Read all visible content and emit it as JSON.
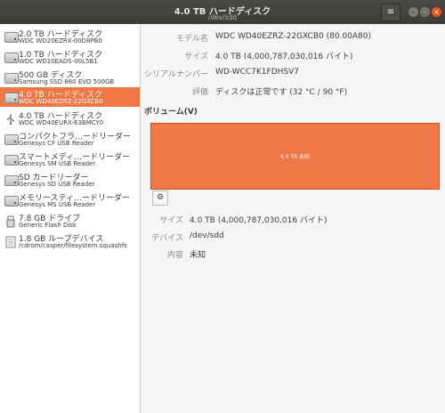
{
  "window": {
    "title": "4.0 TB ハードディスク",
    "subtitle": "/dev/sdd",
    "menu_icon": "hamburger-menu-icon"
  },
  "sidebar": {
    "items": [
      {
        "l1": "2.0 TB ハードディスク",
        "l2": "WDC WD20EZRX-00D8PB0",
        "icon": "hard-disk-icon"
      },
      {
        "l1": "1.0 TB ハードディスク",
        "l2": "WDC WD10EADS-00L5B1",
        "icon": "hard-disk-icon"
      },
      {
        "l1": "500 GB ディスク",
        "l2": "Samsung SSD 860 EVO 500GB",
        "icon": "hard-disk-icon"
      },
      {
        "l1": "4.0 TB ハードディスク",
        "l2": "WDC WD40EZRZ-22GXCB0",
        "icon": "hard-disk-icon",
        "selected": true
      },
      {
        "l1": "4.0 TB ハードディスク",
        "l2": "WDC WD40EURX-63BMCY0",
        "icon": "usb-disk-icon"
      },
      {
        "l1": "コンパクトフラ…ードリーダー",
        "l2": "Genesys CF  USB Reader",
        "icon": "card-reader-icon"
      },
      {
        "l1": "スマートメディ…ードリーダー",
        "l2": "Genesys SM  USB Reader",
        "icon": "card-reader-icon"
      },
      {
        "l1": "SD カードリーダー",
        "l2": "Genesys SD  USB Reader",
        "icon": "card-reader-icon"
      },
      {
        "l1": "メモリースティ…ードリーダー",
        "l2": "Genesys MS  USB Reader",
        "icon": "card-reader-icon"
      },
      {
        "l1": "7.8 GB ドライブ",
        "l2": "Generic Flash Disk",
        "icon": "usb-drive-icon"
      },
      {
        "l1": "1.8 GB ループデバイス",
        "l2": "/cdrom/casper/filesystem.squashfs",
        "icon": "loop-device-icon"
      }
    ]
  },
  "details": {
    "model_label": "モデル名",
    "model_value": "WDC WD40EZRZ-22GXCB0 (80.00A80)",
    "size_label": "サイズ",
    "size_value": "4.0 TB (4,000,787,030,016 バイト)",
    "serial_label": "シリアルナンバー",
    "serial_value": "WD-WCC7K1FDHSV7",
    "assessment_label": "評価",
    "assessment_value": "ディスクは正常です (32 °C / 90 °F)"
  },
  "volumes": {
    "title": "ボリューム(V)",
    "bar_label": "4.0 TB 未知",
    "gear_icon": "gear-icon",
    "size_label": "サイズ",
    "size_value": "4.0 TB (4,000,787,030,016 バイト)",
    "device_label": "デバイス",
    "device_value": "/dev/sdd",
    "contents_label": "内容",
    "contents_value": "未知"
  }
}
